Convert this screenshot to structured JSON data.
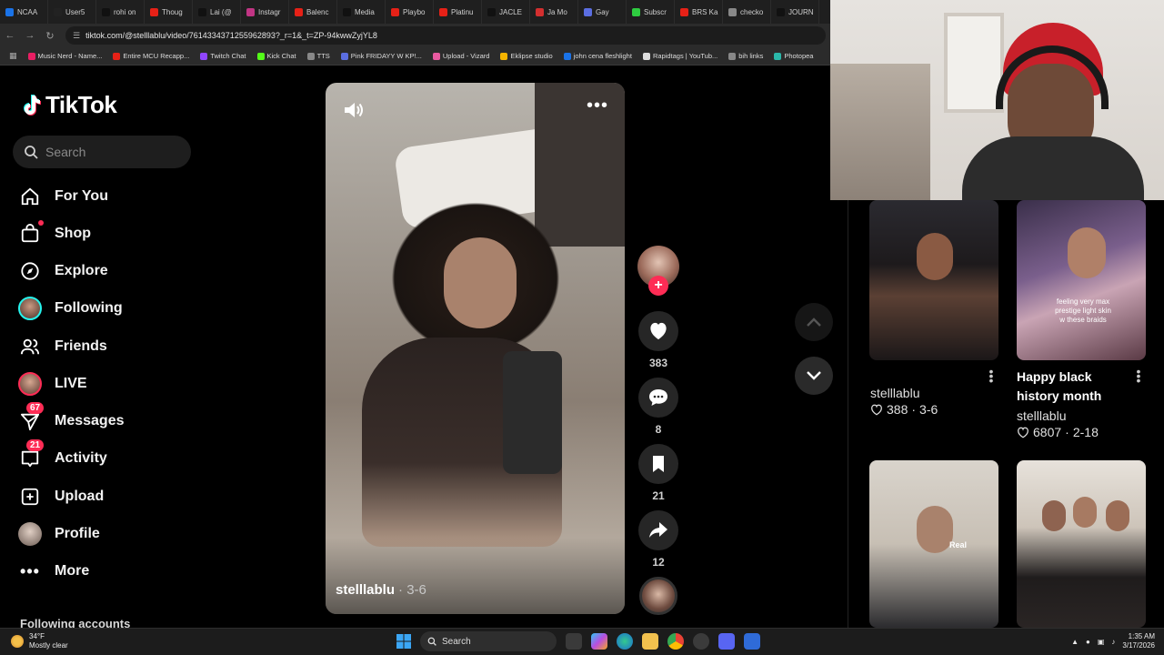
{
  "browser": {
    "tabs": [
      "NCAA",
      "User5",
      "rohi on",
      "Thoug",
      "Lai (@",
      "Instagr",
      "Balenc",
      "Media",
      "Playbo",
      "Platinu",
      "JACLE",
      "Ja Mo",
      "Gay",
      "Subscr",
      "BRS Ka",
      "checko",
      "JOURN"
    ],
    "url": "tiktok.com/@stelllablu/video/7614334371255962893?_r=1&_t=ZP-94kwwZyjYL8",
    "bookmarks": [
      "Music Nerd - Name...",
      "Entire MCU Recapp...",
      "Twitch Chat",
      "Kick Chat",
      "TTS",
      "Pink FRIDAYY W KP!...",
      "Upload - Vizard",
      "Eklipse studio",
      "john cena fleshlight",
      "Rapidtags | YouTub...",
      "bih links",
      "Photopea"
    ]
  },
  "sidebar": {
    "brand": "TikTok",
    "search_placeholder": "Search",
    "items": [
      {
        "label": "For You",
        "icon": "home-icon"
      },
      {
        "label": "Shop",
        "icon": "shop-bag-icon"
      },
      {
        "label": "Explore",
        "icon": "compass-icon"
      },
      {
        "label": "Following",
        "icon": "avatar-icon"
      },
      {
        "label": "Friends",
        "icon": "friends-icon"
      },
      {
        "label": "LIVE",
        "icon": "live-avatar-icon"
      },
      {
        "label": "Messages",
        "icon": "paper-plane-icon",
        "badge": "67"
      },
      {
        "label": "Activity",
        "icon": "inbox-icon",
        "badge": "21"
      },
      {
        "label": "Upload",
        "icon": "plus-square-icon"
      },
      {
        "label": "Profile",
        "icon": "profile-avatar-icon"
      },
      {
        "label": "More",
        "icon": "ellipsis-icon"
      }
    ],
    "following_heading": "Following accounts"
  },
  "video": {
    "username": "stelllablu",
    "date": "· 3-6",
    "likes": "383",
    "comments": "8",
    "saves": "21",
    "shares": "12"
  },
  "related": [
    {
      "title": "",
      "user": "stelllablu",
      "likes": "388",
      "date": "3-6"
    },
    {
      "title": "Happy black history month",
      "overlay": "feeling very max prestige light skin w these braids",
      "user": "stelllablu",
      "likes": "6807",
      "date": "2-18"
    },
    {
      "overlay": "Real"
    },
    {}
  ],
  "taskbar": {
    "weather_temp": "34°F",
    "weather_desc": "Mostly clear",
    "search_label": "Search",
    "time": "1:35 AM",
    "date": "3/17/2026"
  },
  "colors": {
    "accent": "#fe2c55",
    "background": "#000000",
    "sidebar_text": "#f2f2f2"
  }
}
